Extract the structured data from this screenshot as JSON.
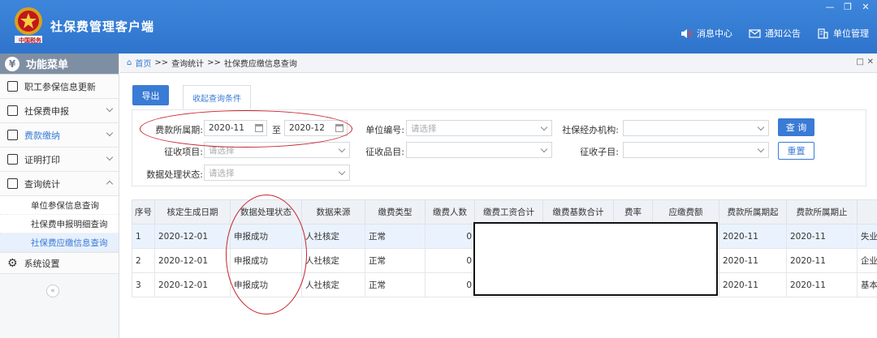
{
  "header": {
    "app_title": "社保费管理客户端",
    "emblem_text": "中国税务",
    "links": [
      {
        "label": "消息中心",
        "icon": "speaker-icon"
      },
      {
        "label": "通知公告",
        "icon": "mail-icon"
      },
      {
        "label": "单位管理",
        "icon": "building-icon"
      }
    ]
  },
  "sidebar": {
    "title": "功能菜单",
    "items": [
      {
        "label": "职工参保信息更新"
      },
      {
        "label": "社保费申报"
      },
      {
        "label": "费款缴纳"
      },
      {
        "label": "证明打印"
      },
      {
        "label": "查询统计"
      }
    ],
    "subitems": [
      {
        "label": "单位参保信息查询"
      },
      {
        "label": "社保费申报明细查询"
      },
      {
        "label": "社保费应缴信息查询"
      }
    ],
    "settings": "系统设置",
    "collapse": "«"
  },
  "breadcrumb": {
    "home": "首页",
    "sep": ">>",
    "level1": "查询统计",
    "level2": "社保费应缴信息查询"
  },
  "toolbar": {
    "export": "导出",
    "collapse_tab": "收起查询条件"
  },
  "filters": {
    "period_label": "费款所属期:",
    "period_from": "2020-11",
    "to": "至",
    "period_to": "2020-12",
    "unit_code_label": "单位编号:",
    "unit_code_placeholder": "请选择",
    "agency_label": "社保经办机构:",
    "item_label": "征收项目:",
    "item_placeholder": "请选择",
    "category_label": "征收品目:",
    "subitem_label": "征收子目:",
    "status_label": "数据处理状态:",
    "status_placeholder": "请选择",
    "query_button": "查 询",
    "reset_button": "重置"
  },
  "table": {
    "headers": [
      "序号",
      "核定生成日期",
      "数据处理状态",
      "数据来源",
      "缴费类型",
      "缴费人数",
      "缴费工资合计",
      "缴费基数合计",
      "费率",
      "应缴费额",
      "费款所属期起",
      "费款所属期止",
      ""
    ],
    "rows": [
      [
        "1",
        "2020-12-01",
        "申报成功",
        "人社核定",
        "正常",
        "0",
        "",
        "",
        "",
        "",
        "2020-11",
        "2020-11",
        "失业"
      ],
      [
        "2",
        "2020-12-01",
        "申报成功",
        "人社核定",
        "正常",
        "0",
        "",
        "",
        "",
        "",
        "2020-11",
        "2020-11",
        "企业"
      ],
      [
        "3",
        "2020-12-01",
        "申报成功",
        "人社核定",
        "正常",
        "0",
        "",
        "",
        "",
        "",
        "2020-11",
        "2020-11",
        "基本"
      ]
    ]
  },
  "colors": {
    "header_blue": "#2f74cc",
    "accent": "#3a7bd5",
    "annotation_red": "#c9242b"
  }
}
